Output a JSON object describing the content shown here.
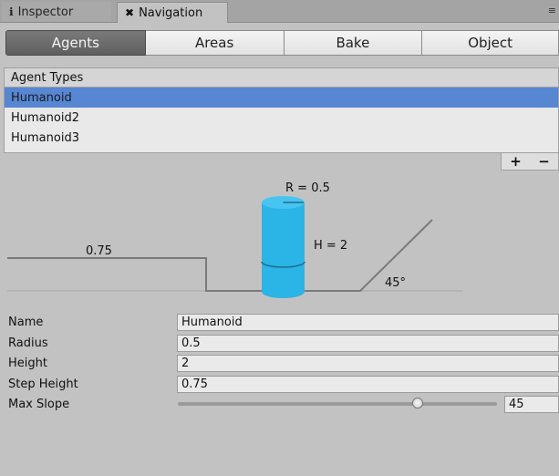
{
  "tabs": [
    {
      "label": "Inspector",
      "icon": "info-icon"
    },
    {
      "label": "Navigation",
      "icon": "navigation-icon"
    }
  ],
  "toolbar": [
    "Agents",
    "Areas",
    "Bake",
    "Object"
  ],
  "agent_list": {
    "header": "Agent Types",
    "items": [
      "Humanoid",
      "Humanoid2",
      "Humanoid3"
    ],
    "selected": 0,
    "add_label": "+",
    "remove_label": "−"
  },
  "diagram": {
    "radius_label": "R = 0.5",
    "height_label": "H = 2",
    "step_label": "0.75",
    "slope_label": "45°",
    "agent_color": "#2bb4e6"
  },
  "properties": {
    "name": {
      "label": "Name",
      "value": "Humanoid"
    },
    "radius": {
      "label": "Radius",
      "value": "0.5"
    },
    "height": {
      "label": "Height",
      "value": "2"
    },
    "step_height": {
      "label": "Step Height",
      "value": "0.75"
    },
    "max_slope": {
      "label": "Max Slope",
      "value": "45",
      "fraction": 0.75
    }
  },
  "colors": {
    "selection": "#5786d3",
    "active_button": "#6b6b6b"
  }
}
